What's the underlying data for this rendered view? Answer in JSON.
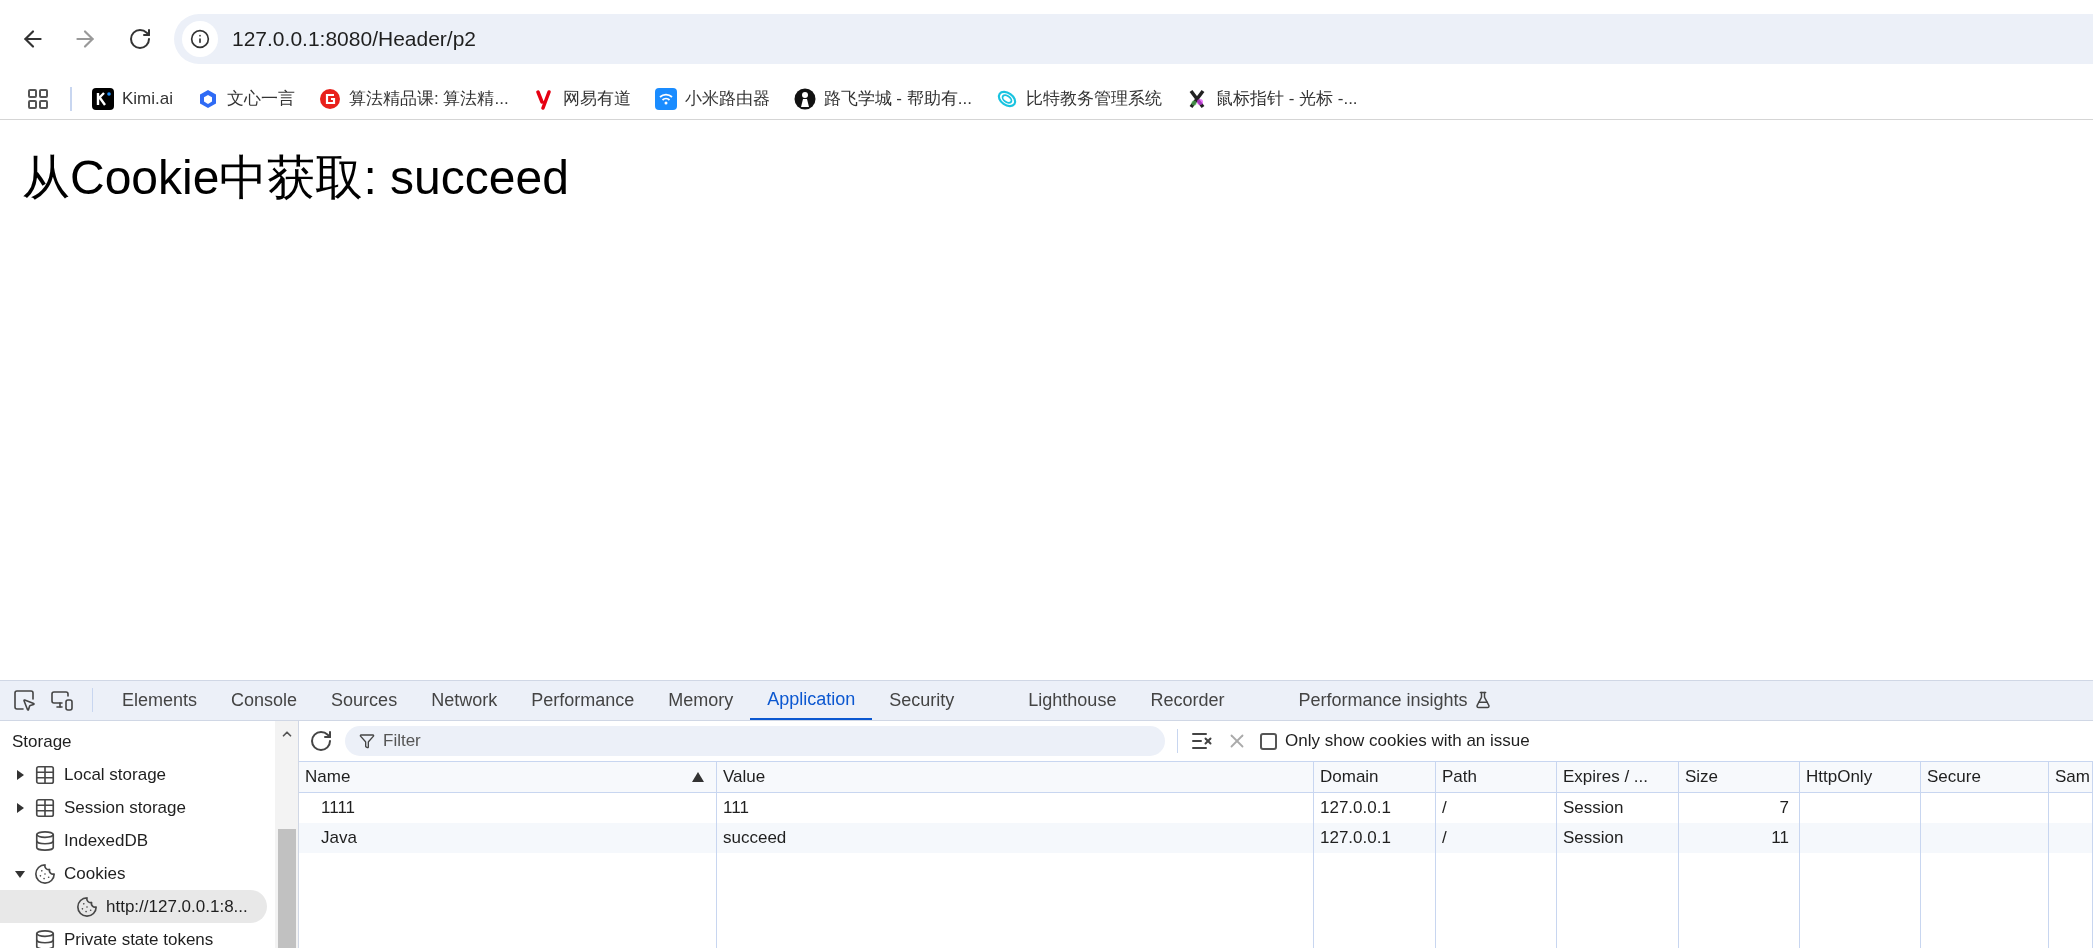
{
  "browser": {
    "url": "127.0.0.1:8080/Header/p2"
  },
  "bookmarks": [
    {
      "label": "Kimi.ai",
      "kind": "k"
    },
    {
      "label": "文心一言",
      "kind": "cube"
    },
    {
      "label": "算法精品课: 算法精...",
      "kind": "g"
    },
    {
      "label": "网易有道",
      "kind": "y"
    },
    {
      "label": "小米路由器",
      "kind": "wifi"
    },
    {
      "label": "路飞学城 - 帮助有...",
      "kind": "person"
    },
    {
      "label": "比特教务管理系统",
      "kind": "swirl"
    },
    {
      "label": "鼠标指针 - 光标 -...",
      "kind": "x"
    }
  ],
  "page": {
    "heading": "从Cookie中获取: succeed"
  },
  "devtools": {
    "tabs": [
      {
        "label": "Elements",
        "selected": false,
        "experimental": false
      },
      {
        "label": "Console",
        "selected": false,
        "experimental": false
      },
      {
        "label": "Sources",
        "selected": false,
        "experimental": false
      },
      {
        "label": "Network",
        "selected": false,
        "experimental": false
      },
      {
        "label": "Performance",
        "selected": false,
        "experimental": false
      },
      {
        "label": "Memory",
        "selected": false,
        "experimental": false
      },
      {
        "label": "Application",
        "selected": true,
        "experimental": false
      },
      {
        "label": "Security",
        "selected": false,
        "experimental": false
      },
      {
        "label": "Lighthouse",
        "selected": false,
        "experimental": false
      },
      {
        "label": "Recorder",
        "selected": false,
        "experimental": false
      },
      {
        "label": "Performance insights",
        "selected": false,
        "experimental": true
      }
    ],
    "sidebar": {
      "heading": "Storage",
      "items": [
        {
          "label": "Local storage",
          "kind": "table",
          "expanded": false,
          "selected": false
        },
        {
          "label": "Session storage",
          "kind": "table",
          "expanded": false,
          "selected": false
        },
        {
          "label": "IndexedDB",
          "kind": "database",
          "selected": false
        },
        {
          "label": "Cookies",
          "kind": "cookie",
          "expanded": true,
          "selected": false,
          "children": [
            {
              "label": "http://127.0.0.1:8...",
              "kind": "cookie",
              "selected": true
            }
          ]
        },
        {
          "label": "Private state tokens",
          "kind": "database",
          "selected": false
        }
      ]
    },
    "toolbar": {
      "filter_placeholder": "Filter",
      "only_issues": {
        "label": "Only show cookies with an issue",
        "checked": false
      }
    },
    "table": {
      "columns": [
        {
          "label": "Name",
          "sorted": true
        },
        {
          "label": "Value"
        },
        {
          "label": "Domain"
        },
        {
          "label": "Path"
        },
        {
          "label": "Expires / ..."
        },
        {
          "label": "Size"
        },
        {
          "label": "HttpOnly"
        },
        {
          "label": "Secure"
        },
        {
          "label": "Sam"
        }
      ],
      "rows": [
        {
          "cells": [
            "1111",
            "111",
            "127.0.0.1",
            "/",
            "Session",
            "7"
          ]
        },
        {
          "cells": [
            "Java",
            "succeed",
            "127.0.0.1",
            "/",
            "Session",
            "11"
          ]
        }
      ]
    }
  }
}
